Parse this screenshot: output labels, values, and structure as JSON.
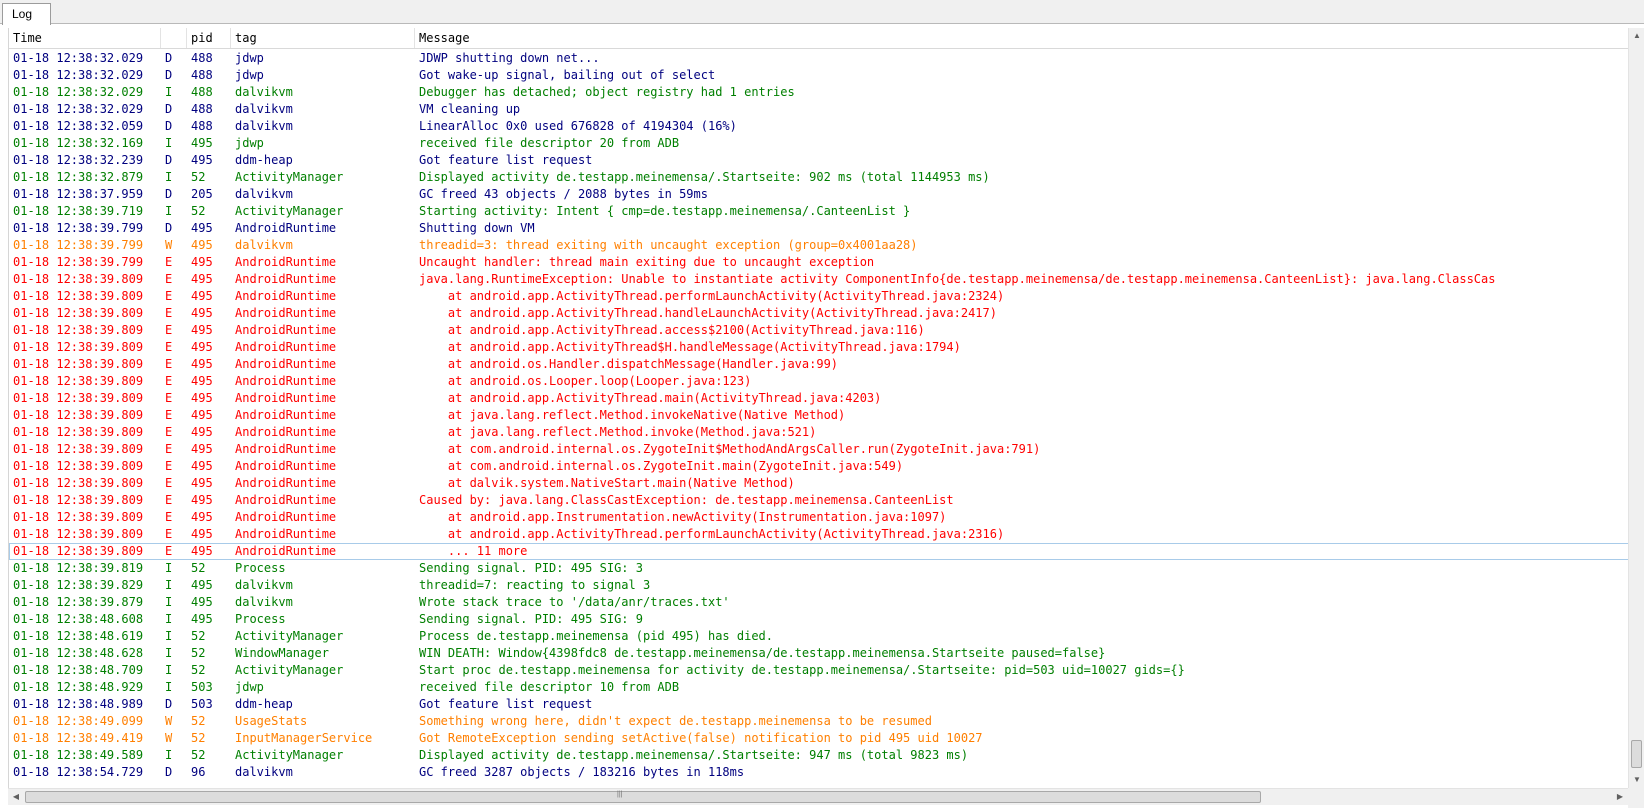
{
  "tab": {
    "label": "Log"
  },
  "columns": {
    "time": "Time",
    "pid": "pid",
    "tag": "tag",
    "message": "Message"
  },
  "colors": {
    "debug": "#00007f",
    "info": "#007f00",
    "warn": "#ff7f00",
    "error": "#ff0000"
  },
  "selected_row": 29,
  "rows": [
    {
      "time": "01-18 12:38:32.029",
      "level": "D",
      "pid": "488",
      "tag": "jdwp",
      "message": "JDWP shutting down net..."
    },
    {
      "time": "01-18 12:38:32.029",
      "level": "D",
      "pid": "488",
      "tag": "jdwp",
      "message": "Got wake-up signal, bailing out of select"
    },
    {
      "time": "01-18 12:38:32.029",
      "level": "I",
      "pid": "488",
      "tag": "dalvikvm",
      "message": "Debugger has detached; object registry had 1 entries"
    },
    {
      "time": "01-18 12:38:32.029",
      "level": "D",
      "pid": "488",
      "tag": "dalvikvm",
      "message": "VM cleaning up"
    },
    {
      "time": "01-18 12:38:32.059",
      "level": "D",
      "pid": "488",
      "tag": "dalvikvm",
      "message": "LinearAlloc 0x0 used 676828 of 4194304 (16%)"
    },
    {
      "time": "01-18 12:38:32.169",
      "level": "I",
      "pid": "495",
      "tag": "jdwp",
      "message": "received file descriptor 20 from ADB"
    },
    {
      "time": "01-18 12:38:32.239",
      "level": "D",
      "pid": "495",
      "tag": "ddm-heap",
      "message": "Got feature list request"
    },
    {
      "time": "01-18 12:38:32.879",
      "level": "I",
      "pid": "52",
      "tag": "ActivityManager",
      "message": "Displayed activity de.testapp.meinemensa/.Startseite: 902 ms (total 1144953 ms)"
    },
    {
      "time": "01-18 12:38:37.959",
      "level": "D",
      "pid": "205",
      "tag": "dalvikvm",
      "message": "GC freed 43 objects / 2088 bytes in 59ms"
    },
    {
      "time": "01-18 12:38:39.719",
      "level": "I",
      "pid": "52",
      "tag": "ActivityManager",
      "message": "Starting activity: Intent { cmp=de.testapp.meinemensa/.CanteenList }"
    },
    {
      "time": "01-18 12:38:39.799",
      "level": "D",
      "pid": "495",
      "tag": "AndroidRuntime",
      "message": "Shutting down VM"
    },
    {
      "time": "01-18 12:38:39.799",
      "level": "W",
      "pid": "495",
      "tag": "dalvikvm",
      "message": "threadid=3: thread exiting with uncaught exception (group=0x4001aa28)"
    },
    {
      "time": "01-18 12:38:39.799",
      "level": "E",
      "pid": "495",
      "tag": "AndroidRuntime",
      "message": "Uncaught handler: thread main exiting due to uncaught exception"
    },
    {
      "time": "01-18 12:38:39.809",
      "level": "E",
      "pid": "495",
      "tag": "AndroidRuntime",
      "message": "java.lang.RuntimeException: Unable to instantiate activity ComponentInfo{de.testapp.meinemensa/de.testapp.meinemensa.CanteenList}: java.lang.ClassCas"
    },
    {
      "time": "01-18 12:38:39.809",
      "level": "E",
      "pid": "495",
      "tag": "AndroidRuntime",
      "message": "    at android.app.ActivityThread.performLaunchActivity(ActivityThread.java:2324)"
    },
    {
      "time": "01-18 12:38:39.809",
      "level": "E",
      "pid": "495",
      "tag": "AndroidRuntime",
      "message": "    at android.app.ActivityThread.handleLaunchActivity(ActivityThread.java:2417)"
    },
    {
      "time": "01-18 12:38:39.809",
      "level": "E",
      "pid": "495",
      "tag": "AndroidRuntime",
      "message": "    at android.app.ActivityThread.access$2100(ActivityThread.java:116)"
    },
    {
      "time": "01-18 12:38:39.809",
      "level": "E",
      "pid": "495",
      "tag": "AndroidRuntime",
      "message": "    at android.app.ActivityThread$H.handleMessage(ActivityThread.java:1794)"
    },
    {
      "time": "01-18 12:38:39.809",
      "level": "E",
      "pid": "495",
      "tag": "AndroidRuntime",
      "message": "    at android.os.Handler.dispatchMessage(Handler.java:99)"
    },
    {
      "time": "01-18 12:38:39.809",
      "level": "E",
      "pid": "495",
      "tag": "AndroidRuntime",
      "message": "    at android.os.Looper.loop(Looper.java:123)"
    },
    {
      "time": "01-18 12:38:39.809",
      "level": "E",
      "pid": "495",
      "tag": "AndroidRuntime",
      "message": "    at android.app.ActivityThread.main(ActivityThread.java:4203)"
    },
    {
      "time": "01-18 12:38:39.809",
      "level": "E",
      "pid": "495",
      "tag": "AndroidRuntime",
      "message": "    at java.lang.reflect.Method.invokeNative(Native Method)"
    },
    {
      "time": "01-18 12:38:39.809",
      "level": "E",
      "pid": "495",
      "tag": "AndroidRuntime",
      "message": "    at java.lang.reflect.Method.invoke(Method.java:521)"
    },
    {
      "time": "01-18 12:38:39.809",
      "level": "E",
      "pid": "495",
      "tag": "AndroidRuntime",
      "message": "    at com.android.internal.os.ZygoteInit$MethodAndArgsCaller.run(ZygoteInit.java:791)"
    },
    {
      "time": "01-18 12:38:39.809",
      "level": "E",
      "pid": "495",
      "tag": "AndroidRuntime",
      "message": "    at com.android.internal.os.ZygoteInit.main(ZygoteInit.java:549)"
    },
    {
      "time": "01-18 12:38:39.809",
      "level": "E",
      "pid": "495",
      "tag": "AndroidRuntime",
      "message": "    at dalvik.system.NativeStart.main(Native Method)"
    },
    {
      "time": "01-18 12:38:39.809",
      "level": "E",
      "pid": "495",
      "tag": "AndroidRuntime",
      "message": "Caused by: java.lang.ClassCastException: de.testapp.meinemensa.CanteenList"
    },
    {
      "time": "01-18 12:38:39.809",
      "level": "E",
      "pid": "495",
      "tag": "AndroidRuntime",
      "message": "    at android.app.Instrumentation.newActivity(Instrumentation.java:1097)"
    },
    {
      "time": "01-18 12:38:39.809",
      "level": "E",
      "pid": "495",
      "tag": "AndroidRuntime",
      "message": "    at android.app.ActivityThread.performLaunchActivity(ActivityThread.java:2316)"
    },
    {
      "time": "01-18 12:38:39.809",
      "level": "E",
      "pid": "495",
      "tag": "AndroidRuntime",
      "message": "    ... 11 more"
    },
    {
      "time": "01-18 12:38:39.819",
      "level": "I",
      "pid": "52",
      "tag": "Process",
      "message": "Sending signal. PID: 495 SIG: 3"
    },
    {
      "time": "01-18 12:38:39.829",
      "level": "I",
      "pid": "495",
      "tag": "dalvikvm",
      "message": "threadid=7: reacting to signal 3"
    },
    {
      "time": "01-18 12:38:39.879",
      "level": "I",
      "pid": "495",
      "tag": "dalvikvm",
      "message": "Wrote stack trace to '/data/anr/traces.txt'"
    },
    {
      "time": "01-18 12:38:48.608",
      "level": "I",
      "pid": "495",
      "tag": "Process",
      "message": "Sending signal. PID: 495 SIG: 9"
    },
    {
      "time": "01-18 12:38:48.619",
      "level": "I",
      "pid": "52",
      "tag": "ActivityManager",
      "message": "Process de.testapp.meinemensa (pid 495) has died."
    },
    {
      "time": "01-18 12:38:48.628",
      "level": "I",
      "pid": "52",
      "tag": "WindowManager",
      "message": "WIN DEATH: Window{4398fdc8 de.testapp.meinemensa/de.testapp.meinemensa.Startseite paused=false}"
    },
    {
      "time": "01-18 12:38:48.709",
      "level": "I",
      "pid": "52",
      "tag": "ActivityManager",
      "message": "Start proc de.testapp.meinemensa for activity de.testapp.meinemensa/.Startseite: pid=503 uid=10027 gids={}"
    },
    {
      "time": "01-18 12:38:48.929",
      "level": "I",
      "pid": "503",
      "tag": "jdwp",
      "message": "received file descriptor 10 from ADB"
    },
    {
      "time": "01-18 12:38:48.989",
      "level": "D",
      "pid": "503",
      "tag": "ddm-heap",
      "message": "Got feature list request"
    },
    {
      "time": "01-18 12:38:49.099",
      "level": "W",
      "pid": "52",
      "tag": "UsageStats",
      "message": "Something wrong here, didn't expect de.testapp.meinemensa to be resumed"
    },
    {
      "time": "01-18 12:38:49.419",
      "level": "W",
      "pid": "52",
      "tag": "InputManagerService",
      "message": "Got RemoteException sending setActive(false) notification to pid 495 uid 10027"
    },
    {
      "time": "01-18 12:38:49.589",
      "level": "I",
      "pid": "52",
      "tag": "ActivityManager",
      "message": "Displayed activity de.testapp.meinemensa/.Startseite: 947 ms (total 9823 ms)"
    },
    {
      "time": "01-18 12:38:54.729",
      "level": "D",
      "pid": "96",
      "tag": "dalvikvm",
      "message": "GC freed 3287 objects / 183216 bytes in 118ms"
    }
  ]
}
